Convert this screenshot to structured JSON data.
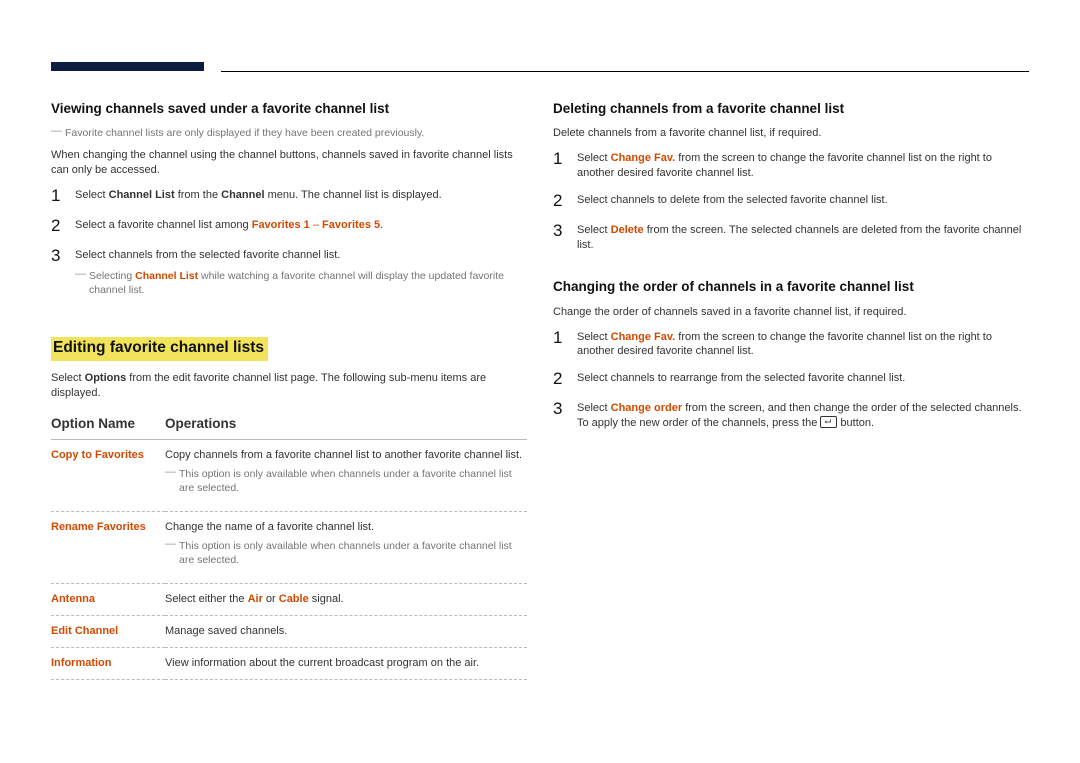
{
  "left": {
    "heading_view": "Viewing channels saved under a favorite channel list",
    "note_view": "Favorite channel lists are only displayed if they have been created previously.",
    "intro_view": "When changing the channel using the channel buttons, channels saved in favorite channel lists can only be accessed.",
    "steps_view": {
      "s1_a": "Select ",
      "s1_b": "Channel List",
      "s1_c": " from the ",
      "s1_d": "Channel",
      "s1_e": " menu. The channel list is displayed.",
      "s2_a": "Select a favorite channel list among ",
      "s2_b": "Favorites 1",
      "s2_c": " – ",
      "s2_d": "Favorites 5",
      "s2_e": ".",
      "s3": "Select channels from the selected favorite channel list.",
      "s3_note_a": "Selecting ",
      "s3_note_b": "Channel List",
      "s3_note_c": " while watching a favorite channel will display the updated favorite channel list."
    },
    "heading_edit": "Editing favorite channel lists",
    "intro_edit_a": "Select ",
    "intro_edit_b": "Options",
    "intro_edit_c": " from the edit favorite channel list page. The following sub-menu items are displayed.",
    "table": {
      "th1": "Option Name",
      "th2": "Operations",
      "rows": [
        {
          "name": "Copy to Favorites",
          "op": "Copy channels from a favorite channel list to another favorite channel list.",
          "note": "This option is only available when channels under a favorite channel list are selected."
        },
        {
          "name": "Rename Favorites",
          "op": "Change the name of a favorite channel list.",
          "note": "This option is only available when channels under a favorite channel list are selected."
        },
        {
          "name": "Antenna",
          "op_a": "Select either the ",
          "op_b": "Air",
          "op_c": " or ",
          "op_d": "Cable",
          "op_e": " signal."
        },
        {
          "name": "Edit Channel",
          "op": "Manage saved channels."
        },
        {
          "name": "Information",
          "op": "View information about the current broadcast program on the air."
        }
      ]
    }
  },
  "right": {
    "heading_del": "Deleting channels from a favorite channel list",
    "intro_del": "Delete channels from a favorite channel list, if required.",
    "steps_del": {
      "s1_a": "Select ",
      "s1_b": "Change Fav.",
      "s1_c": " from the screen to change the favorite channel list on the right to another desired favorite channel list.",
      "s2": "Select channels to delete from the selected favorite channel list.",
      "s3_a": "Select ",
      "s3_b": "Delete",
      "s3_c": " from the screen. The selected channels are deleted from the favorite channel list."
    },
    "heading_order": "Changing the order of channels in a favorite channel list",
    "intro_order": "Change the order of channels saved in a favorite channel list, if required.",
    "steps_order": {
      "s1_a": "Select ",
      "s1_b": "Change Fav.",
      "s1_c": " from the screen to change the favorite channel list on the right to another desired favorite channel list.",
      "s2": "Select channels to rearrange from the selected favorite channel list.",
      "s3_a": "Select ",
      "s3_b": "Change order",
      "s3_c": " from the screen, and then change the order of the selected channels. To apply the new order of the channels, press the ",
      "s3_d": " button."
    }
  }
}
